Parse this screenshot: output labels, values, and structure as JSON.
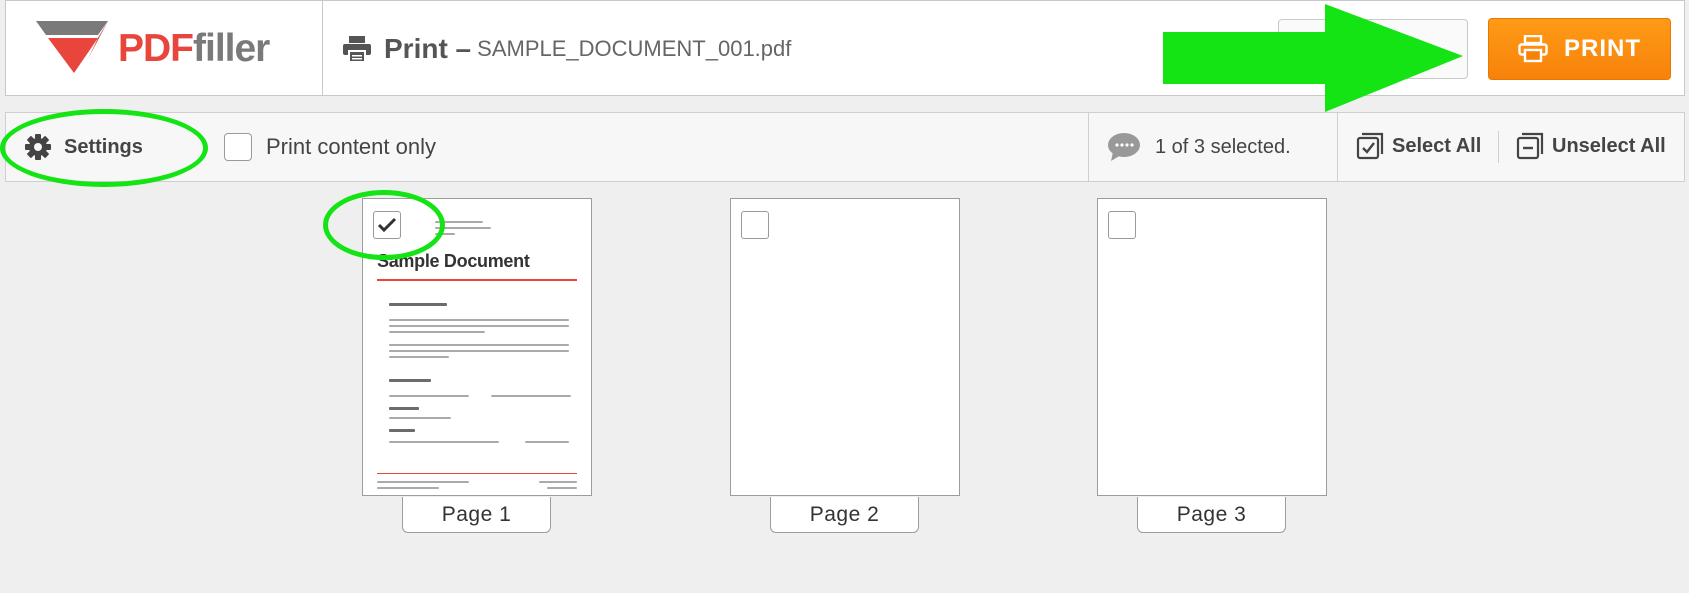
{
  "app": {
    "logo_pdf": "PDF",
    "logo_filler": "filler",
    "title_prefix": "Print –",
    "file_name": "SAMPLE_DOCUMENT_001.pdf",
    "print_button_label": "PRINT"
  },
  "toolbar": {
    "settings_label": "Settings",
    "print_content_only_label": "Print content only",
    "print_content_only_checked": false,
    "selection_status": "1 of 3 selected.",
    "select_all_label": "Select All",
    "unselect_all_label": "Unselect All"
  },
  "pages": [
    {
      "label": "Page 1",
      "selected": true,
      "preview_title": "Sample Document"
    },
    {
      "label": "Page 2",
      "selected": false
    },
    {
      "label": "Page 3",
      "selected": false
    }
  ],
  "colors": {
    "brand_red": "#e8453c",
    "brand_gray": "#7a7a7a",
    "print_orange": "#f7820a",
    "annotation_green": "#14e414"
  },
  "icons": {
    "printer": "printer-icon",
    "settings": "gear-icon",
    "comment": "comment-icon",
    "select_all": "select-all-icon",
    "unselect_all": "unselect-all-icon",
    "check": "checkmark-icon"
  }
}
